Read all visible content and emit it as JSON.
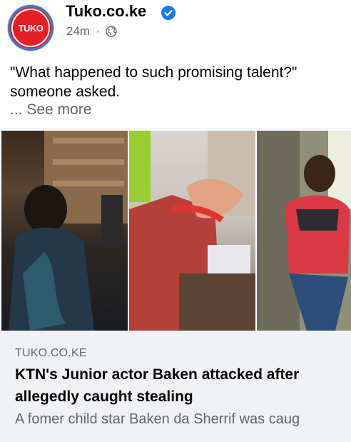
{
  "post": {
    "page_name": "Tuko.co.ke",
    "avatar_logo": "TUKO",
    "timestamp": "24m",
    "separator": "·",
    "audience_icon": "globe-icon",
    "verified_icon": "verified-badge-icon",
    "text": "\"What happened to such promising talent?\" someone asked.",
    "see_more": "... See more"
  },
  "photos": [
    {
      "alt": "photo-left"
    },
    {
      "alt": "photo-middle"
    },
    {
      "alt": "photo-right"
    }
  ],
  "link_preview": {
    "source": "TUKO.CO.KE",
    "headline": "KTN's Junior actor Baken attacked after allegedly caught stealing",
    "description": "A fomer child star Baken da Sherrif was caug"
  },
  "colors": {
    "brand_red": "#e41f26",
    "facebook_blue": "#1877f2",
    "secondary_text": "#65676b",
    "preview_bg": "#f0f2f5"
  }
}
